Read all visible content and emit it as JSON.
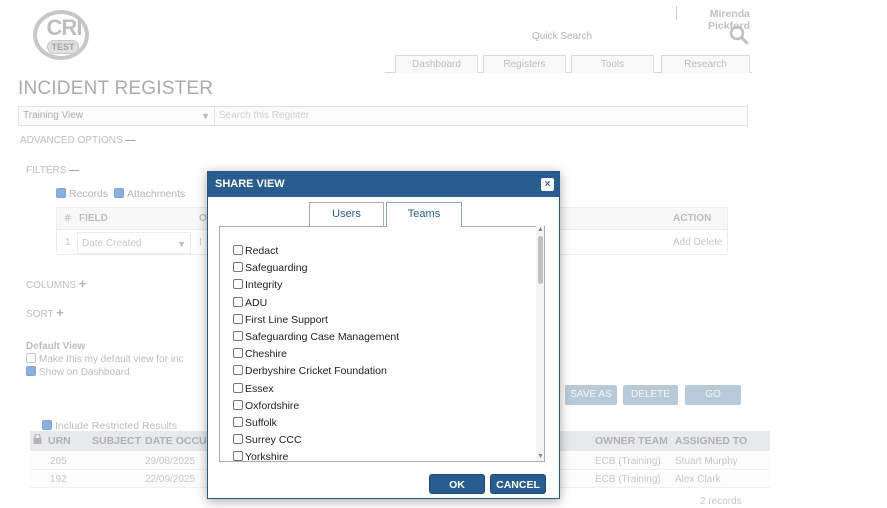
{
  "header": {
    "logo_text": "CRI",
    "logo_badge": "TEST",
    "user_name": "Mirenda Pickford",
    "quick_search_placeholder": "Quick Search",
    "nav": [
      "Dashboard",
      "Registers",
      "Tools",
      "Research"
    ]
  },
  "page_title": "INCIDENT REGISTER",
  "toolbar": {
    "view_value": "Training View",
    "search_placeholder": "Search this Register"
  },
  "advanced_options_label": "ADVANCED OPTIONS",
  "filters": {
    "label": "FILTERS",
    "records_label": "Records",
    "attachments_label": "Attachments",
    "headers": {
      "num": "#",
      "field": "FIELD",
      "op": "O",
      "action": "ACTION"
    },
    "row": {
      "num": "1",
      "field": "Date Created",
      "op": "I",
      "action": "Add Delete"
    }
  },
  "columns_label": "COLUMNS",
  "sort_label": "SORT",
  "default_view": {
    "title": "Default View",
    "make_default": "Make this my default view for inc",
    "show_dashboard": "Show on Dashboard"
  },
  "action_buttons": {
    "save_as": "SAVE AS",
    "delete": "DELETE",
    "go": "GO"
  },
  "restricted_label": "Include Restricted Results",
  "results": {
    "headers": {
      "urn": "URN",
      "subject": "SUBJECT",
      "date": "DATE OCCUR",
      "owner": "OWNER TEAM",
      "assigned": "ASSIGNED TO"
    },
    "rows": [
      {
        "urn": "205",
        "date": "29/08/2025",
        "owner": "ECB (Training)",
        "assigned": "Stuart Murphy"
      },
      {
        "urn": "192",
        "date": "22/09/2025",
        "owner": "ECB (Training)",
        "assigned": "Alex Clark"
      }
    ],
    "count_text": "2 records"
  },
  "modal": {
    "title": "SHARE VIEW",
    "close_glyph": "×",
    "tabs": [
      "Users",
      "Teams"
    ],
    "active_tab": "Teams",
    "teams": [
      "Redact",
      "Safeguarding",
      "Integrity",
      "ADU",
      "First Line Support",
      "Safeguarding Case Management",
      "Cheshire",
      "Derbyshire Cricket Foundation",
      "Essex",
      "Oxfordshire",
      "Suffolk",
      "Surrey CCC",
      "Yorkshire"
    ],
    "ok_label": "OK",
    "cancel_label": "CANCEL"
  },
  "colors": {
    "modal_header": "#2a5d8f",
    "button": "#2a5d8f",
    "checkbox_checked": "#2a6fc9"
  }
}
